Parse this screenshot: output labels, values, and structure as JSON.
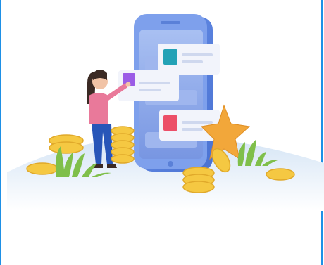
{
  "illustration": {
    "name": "mobile-app-cards-illustration",
    "icons": [
      "person-tapping-card-icon",
      "smartphone-icon",
      "gold-coin-icon",
      "star-icon",
      "grass-icon"
    ]
  },
  "colors": {
    "border": "#1e90e6",
    "phone_body": "#5b86e0",
    "phone_screen": "#7fa1ea",
    "card": "#f2f4fb",
    "teal_square": "#23a2b6",
    "purple_square": "#9b5ce6",
    "red_square": "#ec4f68",
    "coin": "#f5c842",
    "star": "#f2a73a",
    "grass": "#7fbf4a",
    "ground": "#dbe8f6"
  }
}
